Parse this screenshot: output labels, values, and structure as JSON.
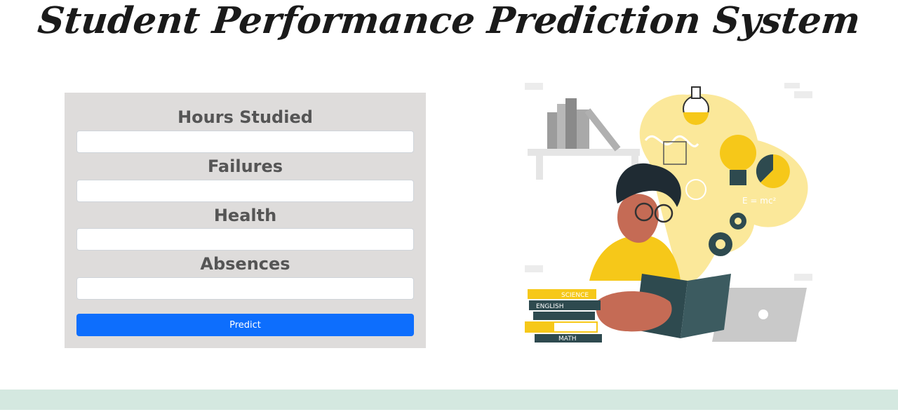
{
  "page": {
    "title": "Student Performance Prediction System"
  },
  "form": {
    "fields": [
      {
        "label": "Hours Studied",
        "value": "",
        "placeholder": ""
      },
      {
        "label": "Failures",
        "value": "",
        "placeholder": ""
      },
      {
        "label": "Health",
        "value": "",
        "placeholder": ""
      },
      {
        "label": "Absences",
        "value": "",
        "placeholder": ""
      }
    ],
    "submit_label": "Predict"
  },
  "illustration": {
    "book_labels": [
      "SCIENCE",
      "ENGLISH",
      "MATH"
    ],
    "formula": "E = mc²"
  },
  "colors": {
    "panel_bg": "#dedcdb",
    "button_bg": "#0d6efd",
    "footer_band": "#d4e8e0",
    "illustration_yellow": "#f6c819"
  }
}
